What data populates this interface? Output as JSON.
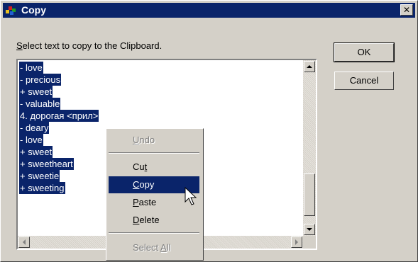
{
  "window": {
    "title": "Copy",
    "close_glyph": "✕"
  },
  "prompt": {
    "mnemonic": "S",
    "rest": "elect text to copy to the Clipboard."
  },
  "text_lines": [
    "- love",
    "- precious",
    "+ sweet",
    "- valuable",
    "4. дорогая <прил>",
    "- deary",
    "- love",
    "+ sweet",
    "+ sweetheart",
    "+ sweetie",
    "+ sweeting"
  ],
  "buttons": {
    "ok": "OK",
    "cancel": "Cancel"
  },
  "context_menu": {
    "items": [
      {
        "id": "undo",
        "pre": "",
        "mn": "U",
        "post": "ndo",
        "disabled": true
      },
      {
        "id": "cut",
        "pre": "Cu",
        "mn": "t",
        "post": "",
        "disabled": false
      },
      {
        "id": "copy",
        "pre": "",
        "mn": "C",
        "post": "opy",
        "selected": true
      },
      {
        "id": "paste",
        "pre": "",
        "mn": "P",
        "post": "aste",
        "disabled": false
      },
      {
        "id": "delete",
        "pre": "",
        "mn": "D",
        "post": "elete",
        "disabled": false
      },
      {
        "id": "select-all",
        "pre": "Select ",
        "mn": "A",
        "post": "ll",
        "disabled": true
      }
    ]
  },
  "colors": {
    "face": "#d4d0c8",
    "selection": "#0a246a",
    "disabled_text": "#808080"
  }
}
